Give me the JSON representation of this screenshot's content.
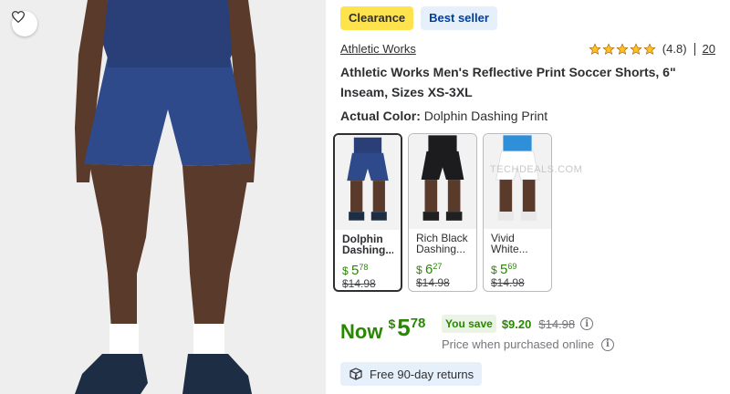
{
  "product": {
    "badges": {
      "clearance": "Clearance",
      "bestseller": "Best seller"
    },
    "brand": "Athletic Works",
    "rating": {
      "value": "(4.8)",
      "count": "20",
      "stars": 5
    },
    "title": "Athletic Works Men's Reflective Print Soccer Shorts, 6\" Inseam, Sizes XS-3XL",
    "color": {
      "label": "Actual Color:",
      "value": "Dolphin Dashing Print"
    }
  },
  "swatches": [
    {
      "name": "Dolphin Dashing...",
      "dollar": "$",
      "whole": "5",
      "cents": "78",
      "was": "$14.98",
      "selected": true,
      "shorts_color": "#2f4a8a",
      "shirt_color": "#2a3e78"
    },
    {
      "name": "Rich Black Dashing...",
      "dollar": "$",
      "whole": "6",
      "cents": "27",
      "was": "$14.98",
      "selected": false,
      "shorts_color": "#1c1c1e",
      "shirt_color": "#1c1c1e"
    },
    {
      "name": "Vivid White...",
      "dollar": "$",
      "whole": "5",
      "cents": "69",
      "was": "$14.98",
      "selected": false,
      "shorts_color": "#f4f4f4",
      "shirt_color": "#2f8fd8"
    }
  ],
  "watermark": "TECHDEALS.COM",
  "pricing": {
    "now_label": "Now",
    "dollar": "$",
    "whole": "5",
    "cents": "78",
    "you_save_label": "You save",
    "save_amount": "$9.20",
    "was_price": "$14.98",
    "ppo_note": "Price when purchased online",
    "info_glyph": "i"
  },
  "returns": {
    "label": "Free 90-day returns"
  },
  "colors": {
    "accent_green": "#2a8703",
    "clearance_yellow": "#ffe34d",
    "bestseller_blue": "#003e9c",
    "star_gold": "#ffc220"
  }
}
